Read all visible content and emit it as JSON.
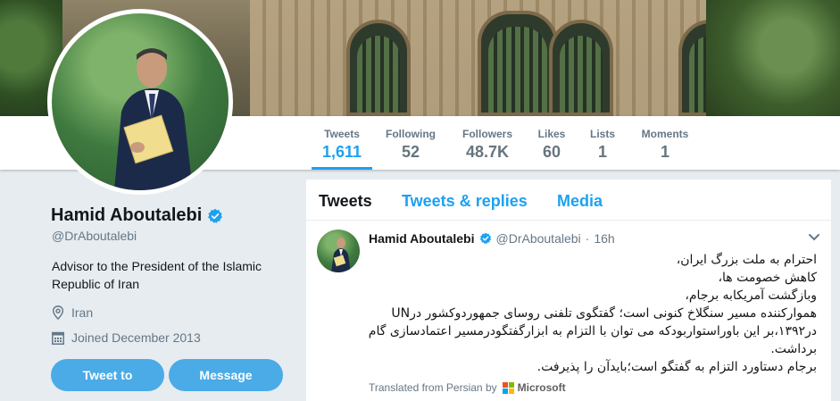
{
  "stats": [
    {
      "label": "Tweets",
      "value": "1,611"
    },
    {
      "label": "Following",
      "value": "52"
    },
    {
      "label": "Followers",
      "value": "48.7K"
    },
    {
      "label": "Likes",
      "value": "60"
    },
    {
      "label": "Lists",
      "value": "1"
    },
    {
      "label": "Moments",
      "value": "1"
    }
  ],
  "profile": {
    "name": "Hamid Aboutalebi",
    "handle": "@DrAboutalebi",
    "bio_line1": "Advisor to the President of the Islamic",
    "bio_line2": "Republic of Iran",
    "location": "Iran",
    "joined": "Joined December 2013",
    "tweet_to_label": "Tweet to",
    "message_label": "Message"
  },
  "timeline": {
    "tabs": [
      "Tweets",
      "Tweets & replies",
      "Media"
    ],
    "tweet": {
      "name": "Hamid Aboutalebi",
      "handle": "@DrAboutalebi",
      "separator": "·",
      "time": "16h",
      "lines": [
        "احترام به ملت بزرگ ایران،",
        "کاهش خصومت ها،",
        "وبازگشت آمریکابه برجام،",
        "هموارکننده مسیر سنگلاخ کنونی است؛ گفتگوی تلفنی روسای جمهوردوکشور درUN",
        "در۱۳۹۲،بر این باوراستواربودکه می توان با التزام به ابزارگفتگودرمسیر اعتمادسازی گام",
        "برداشت.",
        "برجام دستاورد التزام به گفتگو است؛بایدآن را پذیرفت."
      ],
      "translated_prefix": "Translated from Persian by",
      "translator": "Microsoft"
    }
  },
  "colors": {
    "accent": "#1da1f2",
    "button": "#4aabe7",
    "verified": "#1da1f2"
  },
  "icons": [
    "verified-badge-icon",
    "location-pin-icon",
    "calendar-icon",
    "chevron-down-icon",
    "microsoft-logo-icon"
  ]
}
